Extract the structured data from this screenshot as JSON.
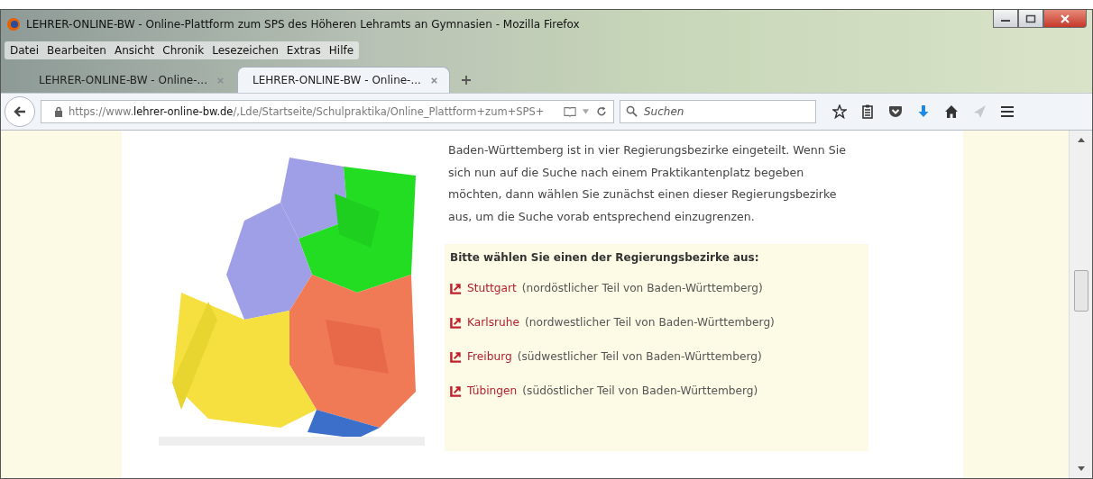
{
  "window": {
    "title": "LEHRER-ONLINE-BW - Online-Plattform zum SPS des Höheren Lehramts an Gymnasien - Mozilla Firefox"
  },
  "menu": [
    "Datei",
    "Bearbeiten",
    "Ansicht",
    "Chronik",
    "Lesezeichen",
    "Extras",
    "Hilfe"
  ],
  "tabs": [
    {
      "label": "LEHRER-ONLINE-BW - Online-...",
      "selected": false
    },
    {
      "label": "LEHRER-ONLINE-BW - Online-...",
      "selected": true
    }
  ],
  "address": {
    "prefix": "https://www.",
    "domain": "lehrer-online-bw.de",
    "path": "/,Lde/Startseite/Schulpraktika/Online_Plattform+zum+SPS+"
  },
  "search": {
    "placeholder": "Suchen"
  },
  "content": {
    "intro": "Baden-Württemberg ist in vier Regierungsbezirke eingeteilt. Wenn Sie sich nun auf die Suche nach einem Praktikantenplatz begeben möchten, dann wählen Sie zunächst einen dieser Regierungsbezirke aus, um die Suche vorab entsprechend einzugrenzen.",
    "box_heading": "Bitte wählen Sie einen der Regierungsbezirke aus:",
    "links": [
      {
        "label": "Stuttgart",
        "note": "(nordöstlicher Teil von Baden-Württemberg)"
      },
      {
        "label": "Karlsruhe",
        "note": "(nordwestlicher Teil von Baden-Württemberg)"
      },
      {
        "label": "Freiburg",
        "note": "(südwestlicher Teil von Baden-Württemberg)"
      },
      {
        "label": "Tübingen",
        "note": "(südöstlicher Teil von Baden-Württemberg)"
      }
    ]
  }
}
